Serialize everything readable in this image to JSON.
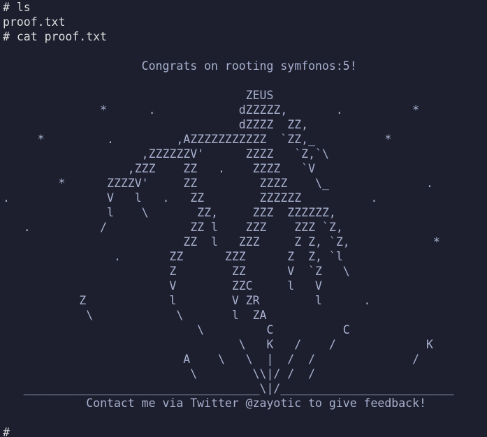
{
  "terminal": {
    "lines": [
      "# ls",
      "proof.txt",
      "# cat proof.txt",
      "",
      "                    Congrats on rooting symfonos:5!",
      "",
      "                                   ZEUS",
      "              *      .            dZZZZZ,       .          *",
      "                                  dZZZZ  ZZ,",
      "     *         .         ,AZZZZZZZZZZZ  `ZZ,_          *",
      "                    ,ZZZZZZV'      ZZZZ   `Z,`\\",
      "                  ,ZZZ    ZZ   .    ZZZZ   `V",
      "        *      ZZZZV'     ZZ         ZZZZ    \\_              .",
      ".              V   l   .   ZZ        ZZZZZZ          .",
      "               l    \\       ZZ,     ZZZ  ZZZZZZ,",
      "   .          /            ZZ l    ZZZ    ZZZ `Z,",
      "                          ZZ  l   ZZZ     Z Z, `Z,            *",
      "                .       ZZ      ZZZ      Z  Z, `l",
      "                        Z        ZZ      V  `Z   \\",
      "                        V        ZZC     l   V",
      "           Z            l        V ZR        l      .",
      "            \\            \\       l  ZA",
      "                            \\         C          C",
      "                                  \\   K   /    /             K",
      "                          A    \\   \\  |  /  /              /",
      "                           \\        \\\\|/ /  /",
      "   __________________________________\\|/_________________________",
      "            Contact me via Twitter @zayotic to give feedback!",
      "",
      "#"
    ]
  }
}
